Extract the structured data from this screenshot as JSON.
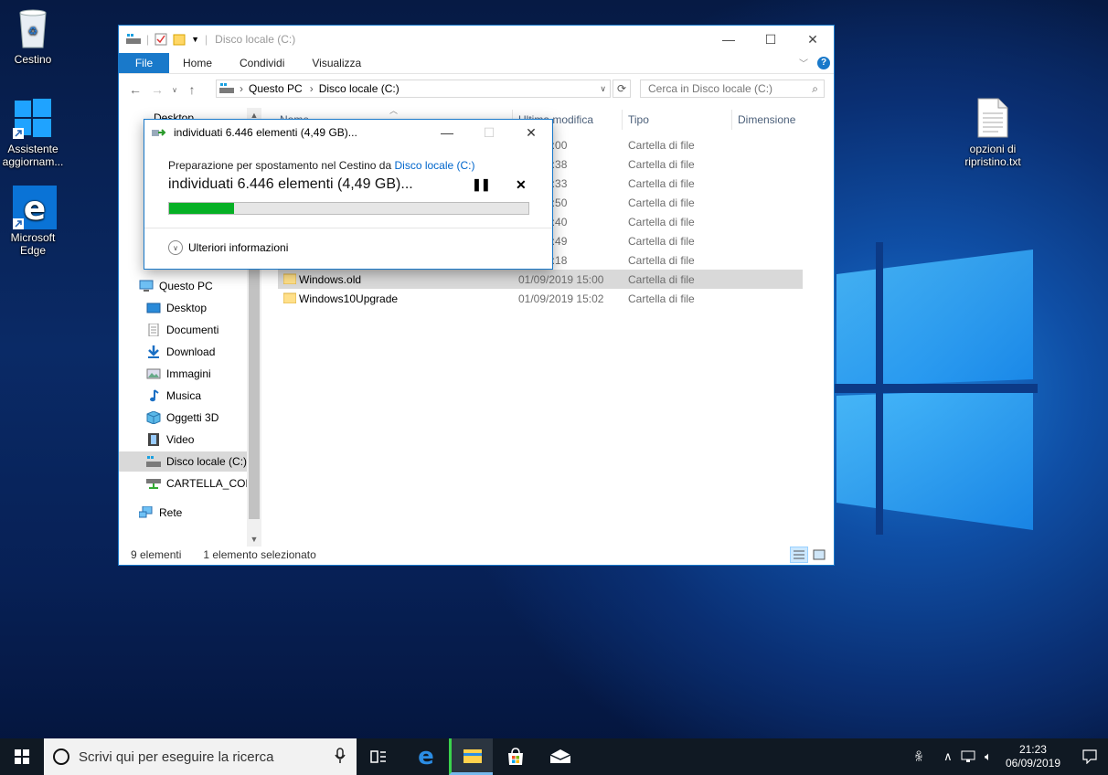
{
  "desktop": {
    "icons": [
      {
        "label": "Cestino"
      },
      {
        "label": "Assistente aggiornam..."
      },
      {
        "label": "Microsoft Edge"
      },
      {
        "label": "opzioni di ripristino.txt"
      }
    ]
  },
  "explorer": {
    "title": "Disco locale (C:)",
    "ribbon": {
      "file": "File",
      "tabs": [
        "Home",
        "Condividi",
        "Visualizza"
      ]
    },
    "address": {
      "crumbs": [
        "Questo PC",
        "Disco locale (C:)"
      ]
    },
    "search": {
      "placeholder": "Cerca in Disco locale (C:)"
    },
    "columns": {
      "name": "Nome",
      "date": "Ultima modifica",
      "type": "Tipo",
      "size": "Dimensione"
    },
    "nav": {
      "top_item": "Desktop",
      "items": [
        "Questo PC",
        "Desktop",
        "Documenti",
        "Download",
        "Immagini",
        "Musica",
        "Oggetti 3D",
        "Video",
        "Disco locale (C:)",
        "CARTELLA_CON",
        "Rete"
      ]
    },
    "rows": [
      {
        "name": "",
        "date": "01/09/2019 15:00",
        "type": "Cartella di file",
        "date_visible": "019 15:00"
      },
      {
        "name": "",
        "date": "2018 01:38",
        "type": "Cartella di file",
        "date_visible": "018 01:38"
      },
      {
        "name": "",
        "date": "2019 15:33",
        "type": "Cartella di file",
        "date_visible": "019 15:33"
      },
      {
        "name": "",
        "date": "2019 15:50",
        "type": "Cartella di file",
        "date_visible": "019 15:50"
      },
      {
        "name": "",
        "date": "2019 15:40",
        "type": "Cartella di file",
        "date_visible": "019 15:40"
      },
      {
        "name": "",
        "date": "2019 14:49",
        "type": "Cartella di file",
        "date_visible": "019 14:49"
      },
      {
        "name": "",
        "date": "2019 21:18",
        "type": "Cartella di file",
        "date_visible": "019 21:18"
      },
      {
        "name": "Windows.old",
        "date": "01/09/2019 15:00",
        "type": "Cartella di file",
        "date_visible": "01/09/2019 15:00"
      },
      {
        "name": "Windows10Upgrade",
        "date": "01/09/2019 15:02",
        "type": "Cartella di file",
        "date_visible": "01/09/2019 15:02"
      }
    ],
    "status": {
      "count": "9 elementi",
      "selected": "1 elemento selezionato"
    }
  },
  "dialog": {
    "title": "individuati 6.446 elementi (4,49 GB)...",
    "line1_prefix": "Preparazione per spostamento nel Cestino da ",
    "line1_link": "Disco locale (C:)",
    "line2": "individuati 6.446 elementi (4,49 GB)...",
    "progress_fraction": 0.18,
    "more": "Ulteriori informazioni"
  },
  "taskbar": {
    "search_placeholder": "Scrivi qui per eseguire la ricerca",
    "time": "21:23",
    "date": "06/09/2019"
  },
  "colors": {
    "accent": "#1979ca",
    "progress": "#06b025",
    "selection": "#d9d9d9",
    "taskbar": "#101923"
  }
}
